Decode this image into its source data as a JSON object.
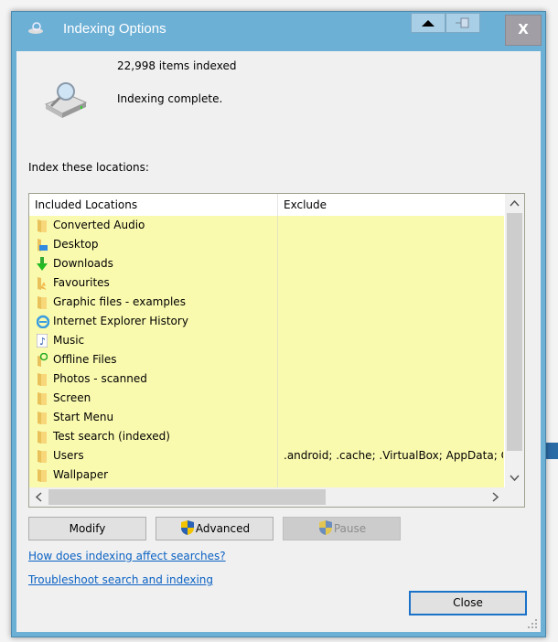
{
  "window": {
    "title": "Indexing Options",
    "close_label": "X"
  },
  "status": {
    "items_indexed": "22,998 items indexed",
    "state": "Indexing complete."
  },
  "locations_label": "Index these locations:",
  "table": {
    "columns": [
      "Included Locations",
      "Exclude"
    ],
    "rows": [
      {
        "name": "Converted Audio",
        "exclude": "",
        "icon": "folder-icon"
      },
      {
        "name": "Desktop",
        "exclude": "",
        "icon": "desktop-icon"
      },
      {
        "name": "Downloads",
        "exclude": "",
        "icon": "download-icon"
      },
      {
        "name": "Favourites",
        "exclude": "",
        "icon": "favourites-icon"
      },
      {
        "name": "Graphic files - examples",
        "exclude": "",
        "icon": "folder-icon"
      },
      {
        "name": "Internet Explorer History",
        "exclude": "",
        "icon": "ie-icon"
      },
      {
        "name": "Music",
        "exclude": "",
        "icon": "music-icon"
      },
      {
        "name": "Offline Files",
        "exclude": "",
        "icon": "offline-files-icon"
      },
      {
        "name": "Photos - scanned",
        "exclude": "",
        "icon": "folder-icon"
      },
      {
        "name": "Screen",
        "exclude": "",
        "icon": "folder-icon"
      },
      {
        "name": "Start Menu",
        "exclude": "",
        "icon": "folder-icon"
      },
      {
        "name": "Test search (indexed)",
        "exclude": "",
        "icon": "folder-icon"
      },
      {
        "name": "Users",
        "exclude": ".android; .cache; .VirtualBox; AppData; Co",
        "icon": "folder-icon"
      },
      {
        "name": "Wallpaper",
        "exclude": "",
        "icon": "folder-icon"
      }
    ]
  },
  "buttons": {
    "modify": "Modify",
    "advanced": "Advanced",
    "pause": "Pause",
    "close": "Close"
  },
  "links": {
    "how": "How does indexing affect searches?",
    "troubleshoot": "Troubleshoot search and indexing"
  },
  "colors": {
    "list_bg": "#fafaaf",
    "link": "#0b62c4",
    "titlebar": "#6db0d6"
  }
}
